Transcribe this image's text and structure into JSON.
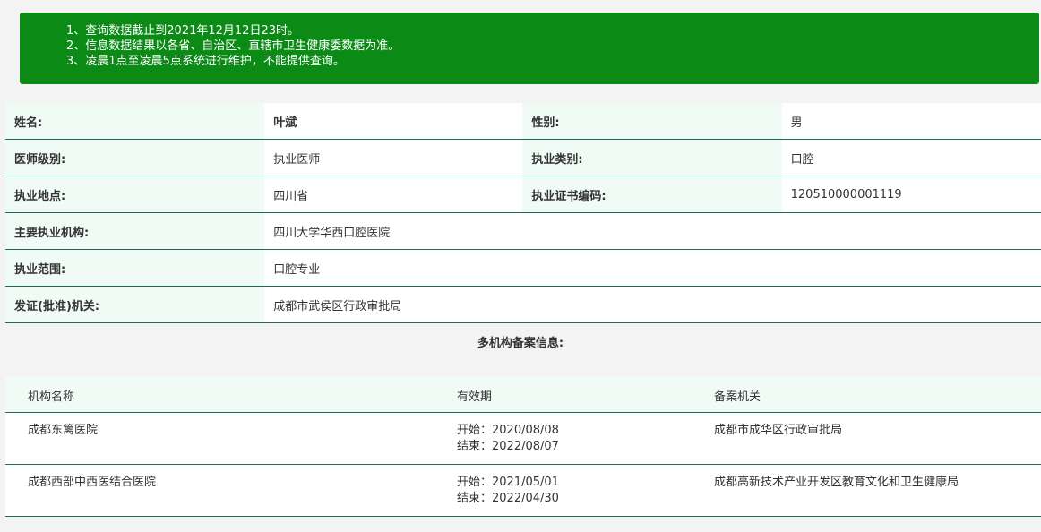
{
  "notice": {
    "lines": [
      "1、查询数据截止到2021年12月12日23时。",
      "2、信息数据结果以各省、自治区、直辖市卫生健康委数据为准。",
      "3、凌晨1点至凌晨5点系统进行维护，不能提供查询。"
    ],
    "color": "#0b8a16"
  },
  "info": {
    "name_label": "姓名:",
    "name_value": "叶斌",
    "gender_label": "性别:",
    "gender_value": "男",
    "level_label": "医师级别:",
    "level_value": "执业医师",
    "category_label": "执业类别:",
    "category_value": "口腔",
    "location_label": "执业地点:",
    "location_value": "四川省",
    "cert_label": "执业证书编码:",
    "cert_value": "120510000001119",
    "institution_label": "主要执业机构:",
    "institution_value": "四川大学华西口腔医院",
    "scope_label": "执业范围:",
    "scope_value": "口腔专业",
    "issuer_label": "发证(批准)机关:",
    "issuer_value": "成都市武侯区行政审批局"
  },
  "multi": {
    "title": "多机构备案信息:",
    "headers": [
      "机构名称",
      "有效期",
      "备案机关"
    ],
    "rows": [
      {
        "institution": "成都东篱医院",
        "start": "开始：2020/08/08",
        "end": "结束：2022/08/07",
        "authority": "成都市成华区行政审批局"
      },
      {
        "institution": "成都西部中西医结合医院",
        "start": "开始：2021/05/01",
        "end": "结束：2022/04/30",
        "authority": "成都高新技术产业开发区教育文化和卫生健康局"
      }
    ]
  },
  "colors": {
    "label_bg": "#f0fbf6",
    "border": "#1a6b5a"
  }
}
